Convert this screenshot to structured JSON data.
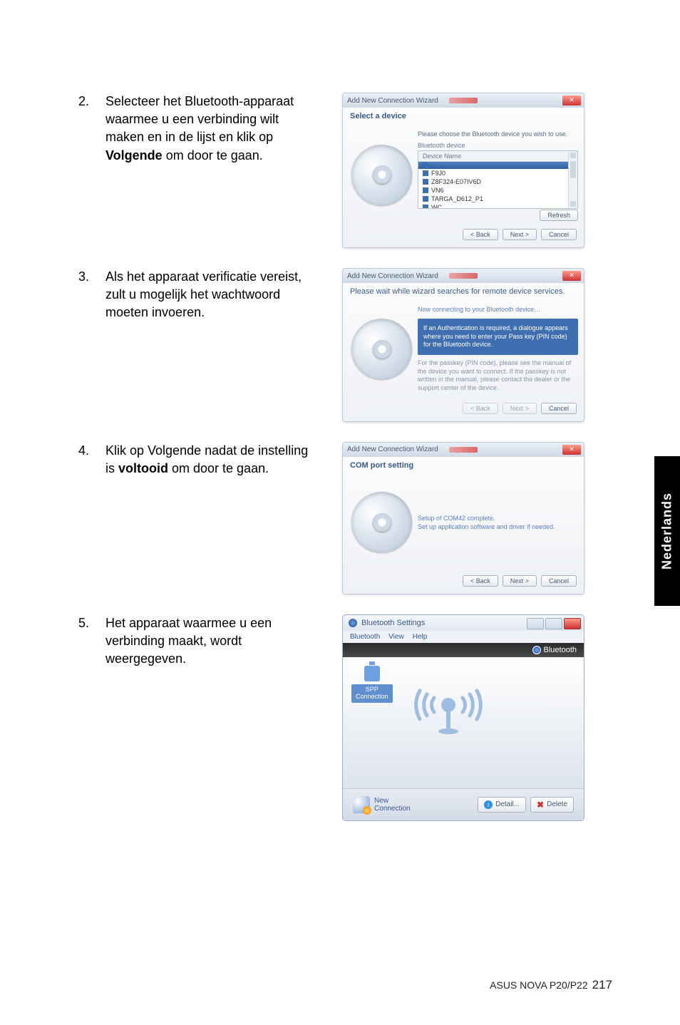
{
  "sidebar_label": "Nederlands",
  "footer": {
    "product": "ASUS NOVA P20/P22",
    "page": "217"
  },
  "steps": [
    {
      "num": "2.",
      "text_parts": [
        "Selecteer het Bluetooth-apparaat waarmee u een verbinding wilt maken en in de lijst en klik op ",
        "Volgende",
        " om door te gaan."
      ]
    },
    {
      "num": "3.",
      "text_parts": [
        "Als het apparaat verificatie vereist, zult u mogelijk het wachtwoord moeten invoeren."
      ]
    },
    {
      "num": "4.",
      "text_parts": [
        "Klik op Volgende nadat de instelling is ",
        "voltooid",
        " om door te gaan."
      ]
    },
    {
      "num": "5.",
      "text_parts": [
        "Het apparaat waarmee u een verbinding maakt, wordt weergegeven."
      ]
    }
  ],
  "dlg1": {
    "title": "Add New Connection Wizard",
    "sub": "Select a device",
    "prompt": "Please choose the Bluetooth device you wish to use.",
    "field": "Bluetooth device",
    "listhead": "Device Name",
    "items": [
      "",
      "F9J0",
      "Z8F324-E07IV6D",
      "VN6",
      "TARGA_D612_P1",
      "WC"
    ],
    "refresh": "Refresh",
    "back": "< Back",
    "next": "Next >",
    "cancel": "Cancel"
  },
  "dlg2": {
    "title": "Add New Connection Wizard",
    "sub": "Please wait while wizard searches for remote device services.",
    "line1": "Now connecting to your Bluetooth device…",
    "box": "If an Authentication is required, a dialogue appears where you need to enter your Pass key (PIN code) for the Bluetooth device.",
    "gray": "For the passkey (PIN code), please see the manual of the device you want to connect. If the passkey is not written in the manual, please contact the dealer or the support center of the device.",
    "back": "< Back",
    "next": "Next >",
    "cancel": "Cancel"
  },
  "dlg3": {
    "title": "Add New Connection Wizard",
    "sub": "COM port setting",
    "line1": "Setup of COM42 complete.",
    "line2": "Set up application software and driver if needed.",
    "back": "< Back",
    "next": "Next >",
    "cancel": "Cancel"
  },
  "settings": {
    "title": "Bluetooth Settings",
    "menus": [
      "Bluetooth",
      "View",
      "Help"
    ],
    "brand": "Bluetooth",
    "spp1": "SPP",
    "spp2": "Connection",
    "newconn1": "New",
    "newconn2": "Connection",
    "detail": "Detail...",
    "delete": "Delete"
  }
}
